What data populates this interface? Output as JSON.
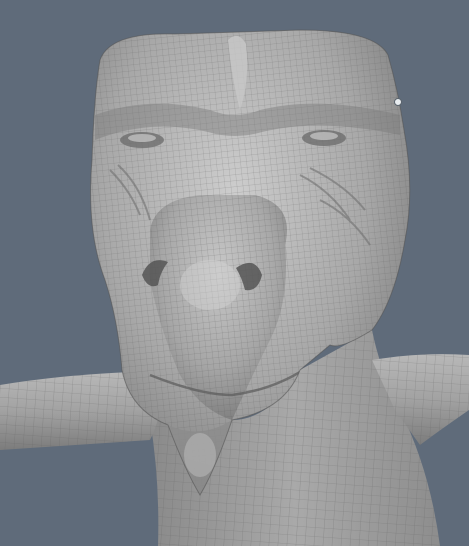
{
  "viewport": {
    "background_color": "#5f6b7a",
    "mesh_fill_color": "#a3a3a3",
    "mesh_highlight_color": "#d4d4d4",
    "mesh_shadow_color": "#4d4d4d",
    "wireframe_color": "#6b6b6b",
    "subject": "sculpted-creature-head-wireframe",
    "shading": "matcap-gray"
  }
}
